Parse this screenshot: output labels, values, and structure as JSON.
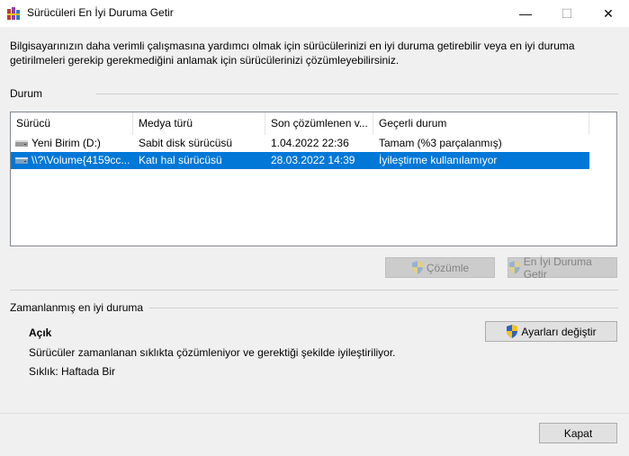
{
  "window": {
    "title": "Sürücüleri En İyi Duruma Getir",
    "minimize_glyph": "—",
    "maximize_glyph": "☐",
    "close_glyph": "✕"
  },
  "description": "Bilgisayarınızın daha verimli çalışmasına yardımcı olmak için sürücülerinizi en iyi duruma getirebilir veya en iyi duruma getirilmeleri gerekip gerekmediğini anlamak için sürücülerinizi çözümleyebilirsiniz.",
  "status": {
    "section_title": "Durum",
    "columns": [
      "Sürücü",
      "Medya türü",
      "Son çözümlenen v...",
      "Geçerli durum"
    ],
    "rows": [
      {
        "drive": "Yeni Birim (D:)",
        "media_type": "Sabit disk sürücüsü",
        "last_run": "1.04.2022 22:36",
        "current_status": "Tamam (%3 parçalanmış)",
        "selected": false
      },
      {
        "drive": "\\\\?\\Volume{4159cc...",
        "media_type": "Katı hal sürücüsü",
        "last_run": "28.03.2022 14:39",
        "current_status": "İyileştirme kullanılamıyor",
        "selected": true
      }
    ],
    "analyze_button": "Çözümle",
    "optimize_button": "En İyi Duruma Getir"
  },
  "schedule": {
    "section_title": "Zamanlanmış en iyi duruma",
    "state": "Açık",
    "info": "Sürücüler zamanlanan sıklıkta çözümleniyor ve gerektiği şekilde iyileştiriliyor.",
    "frequency": "Sıklık: Haftada Bir",
    "change_settings_button": "Ayarları değiştir"
  },
  "close_button": "Kapat",
  "colors": {
    "selection": "#0078d7",
    "disabled_button": "#cccccc",
    "shield_blue": "#2b63c6",
    "shield_yellow": "#f6c21a"
  }
}
